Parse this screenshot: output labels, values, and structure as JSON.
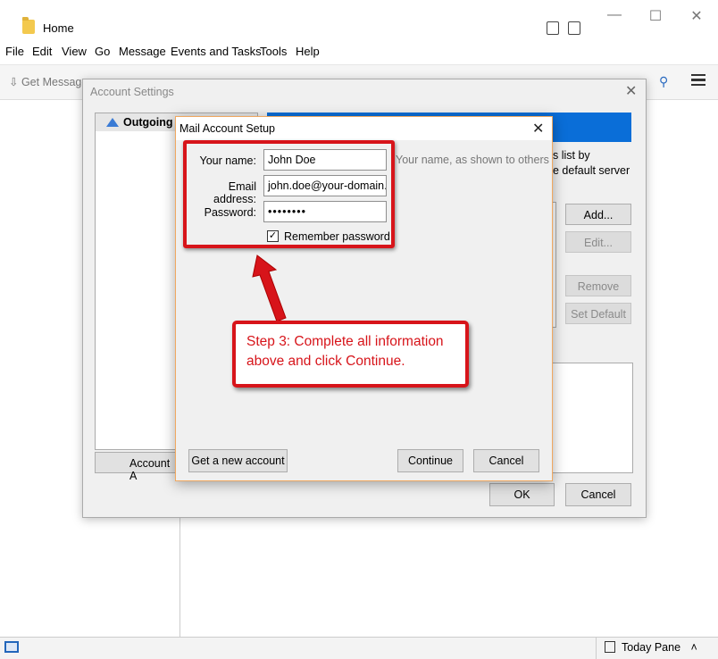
{
  "window": {
    "title": "Home",
    "controls": {
      "minimize": "—",
      "maximize": "☐",
      "close": "✕"
    }
  },
  "menubar": [
    "File",
    "Edit",
    "View",
    "Go",
    "Message",
    "Events and Tasks",
    "Tools",
    "Help"
  ],
  "toolbar": {
    "get_messages": "Get Messages"
  },
  "status": {
    "today_pane": "Today Pane",
    "chevron": "˄"
  },
  "account_settings": {
    "title": "Account Settings",
    "list_item": "Outgoing S",
    "desc": "s list by\ne default server",
    "buttons": {
      "add": "Add...",
      "edit": "Edit...",
      "remove": "Remove",
      "set_default": "Set Default",
      "ok": "OK",
      "cancel": "Cancel",
      "account_actions": "Account A"
    }
  },
  "mail_setup": {
    "title": "Mail Account Setup",
    "labels": {
      "name": "Your name:",
      "email": "Email address:",
      "password": "Password:"
    },
    "values": {
      "name": "John Doe",
      "email": "john.doe@your-domain.",
      "password": "••••••••"
    },
    "name_hint": "Your name, as shown to others",
    "remember": "Remember password",
    "remember_checked": true,
    "buttons": {
      "new_account": "Get a new account",
      "continue": "Continue",
      "cancel": "Cancel"
    }
  },
  "annotation": {
    "line1": "Step 3: Complete all information",
    "line2": "above and click Continue."
  },
  "colors": {
    "highlight": "#d7141a",
    "accent": "#0a6ed8"
  }
}
